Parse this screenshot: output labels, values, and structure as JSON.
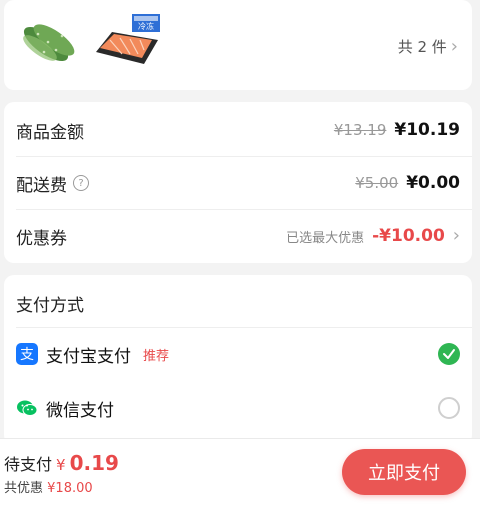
{
  "products": {
    "items": [
      {
        "name": "cucumber"
      },
      {
        "name": "salmon",
        "badge": "冷冻"
      }
    ],
    "count_text": "共 2 件"
  },
  "amounts": {
    "goods": {
      "label": "商品金额",
      "original": "¥13.19",
      "current": "¥10.19"
    },
    "delivery": {
      "label": "配送费",
      "original": "¥5.00",
      "current": "¥0.00"
    },
    "coupon": {
      "label": "优惠券",
      "note": "已选最大优惠",
      "value": "-¥10.00"
    }
  },
  "payment": {
    "title": "支付方式",
    "methods": [
      {
        "name": "支付宝支付",
        "tag": "推荐",
        "selected": true,
        "icon": "alipay-icon"
      },
      {
        "name": "微信支付",
        "tag": "",
        "selected": false,
        "icon": "wechat-icon"
      }
    ]
  },
  "bottom": {
    "pending_label": "待支付",
    "currency": "¥",
    "amount": "0.19",
    "saved_label": "共优惠",
    "saved_amount": "¥18.00",
    "pay_button": "立即支付"
  },
  "colors": {
    "accent_red": "#e8494a",
    "selected_green": "#2fb653",
    "alipay_blue": "#1677ff",
    "wechat_green": "#07c160"
  }
}
